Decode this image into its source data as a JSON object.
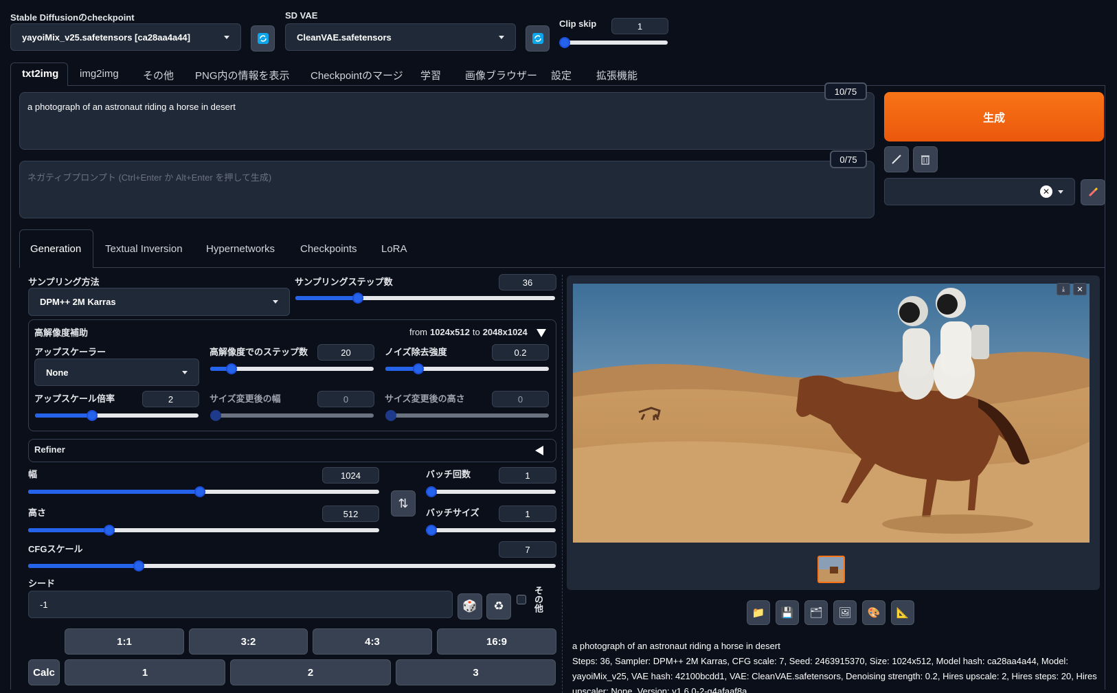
{
  "top": {
    "checkpoint_label": "Stable Diffusionのcheckpoint",
    "checkpoint_value": "yayoiMix_v25.safetensors [ca28aa4a44]",
    "vae_label": "SD VAE",
    "vae_value": "CleanVAE.safetensors",
    "clipskip_label": "Clip skip",
    "clipskip_value": "1",
    "clipskip_level": 0.0
  },
  "main_tabs": [
    "txt2img",
    "img2img",
    "その他",
    "PNG内の情報を表示",
    "Checkpointのマージ",
    "学習",
    "画像ブラウザー",
    "設定",
    "拡張機能"
  ],
  "prompt": {
    "text": "a photograph of an astronaut riding a horse in desert",
    "token_count": "10/75",
    "negative_placeholder": "ネガティブプロンプト (Ctrl+Enter か Alt+Enter を押して生成)",
    "negative_token_count": "0/75"
  },
  "generate": {
    "label": "生成",
    "accent": "#f97316"
  },
  "sub_tabs": [
    "Generation",
    "Textual Inversion",
    "Hypernetworks",
    "Checkpoints",
    "LoRA"
  ],
  "sampling": {
    "method_label": "サンプリング方法",
    "method_value": "DPM++ 2M Karras",
    "steps_label": "サンプリングステップ数",
    "steps_value": "36",
    "steps_level": 0.24
  },
  "hires": {
    "title": "高解像度補助",
    "from_prefix": "from",
    "from_size": "1024x512",
    "to_prefix": "to",
    "to_size": "2048x1024",
    "upscaler_label": "アップスケーラー",
    "upscaler_value": "None",
    "hires_steps_label": "高解像度でのステップ数",
    "hires_steps_value": "20",
    "hires_steps_level": 0.13,
    "denoise_label": "ノイズ除去強度",
    "denoise_value": "0.2",
    "denoise_level": 0.2,
    "upscale_by_label": "アップスケール倍率",
    "upscale_by_value": "2",
    "upscale_by_level": 0.35,
    "resize_w_label": "サイズ変更後の幅",
    "resize_w_value": "0",
    "resize_h_label": "サイズ変更後の高さ",
    "resize_h_value": "0"
  },
  "refiner": {
    "title": "Refiner"
  },
  "size": {
    "width_label": "幅",
    "width_value": "1024",
    "width_level": 0.49,
    "height_label": "高さ",
    "height_value": "512",
    "height_level": 0.23,
    "batch_count_label": "バッチ回数",
    "batch_count_value": "1",
    "batch_size_label": "バッチサイズ",
    "batch_size_value": "1"
  },
  "cfg": {
    "label": "CFGスケール",
    "value": "7",
    "level": 0.21
  },
  "seed": {
    "label": "シード",
    "value": "-1",
    "extra_label": "その他"
  },
  "aspect": {
    "ratios": [
      "1:1",
      "3:2",
      "4:3",
      "16:9"
    ],
    "calc_label": "Calc",
    "multipliers": [
      "1",
      "2",
      "3"
    ]
  },
  "output": {
    "caption": "a photograph of an astronaut riding a horse in desert",
    "params": "Steps: 36, Sampler: DPM++ 2M Karras, CFG scale: 7, Seed: 2463915370, Size: 1024x512, Model hash: ca28aa4a44, Model: yayoiMix_v25, VAE hash: 42100bcdd1, VAE: CleanVAE.safetensors, Denoising strength: 0.2, Hires upscale: 2, Hires steps: 20, Hires upscaler: None, Version: v1.6.0-2-g4afaaf8a"
  }
}
